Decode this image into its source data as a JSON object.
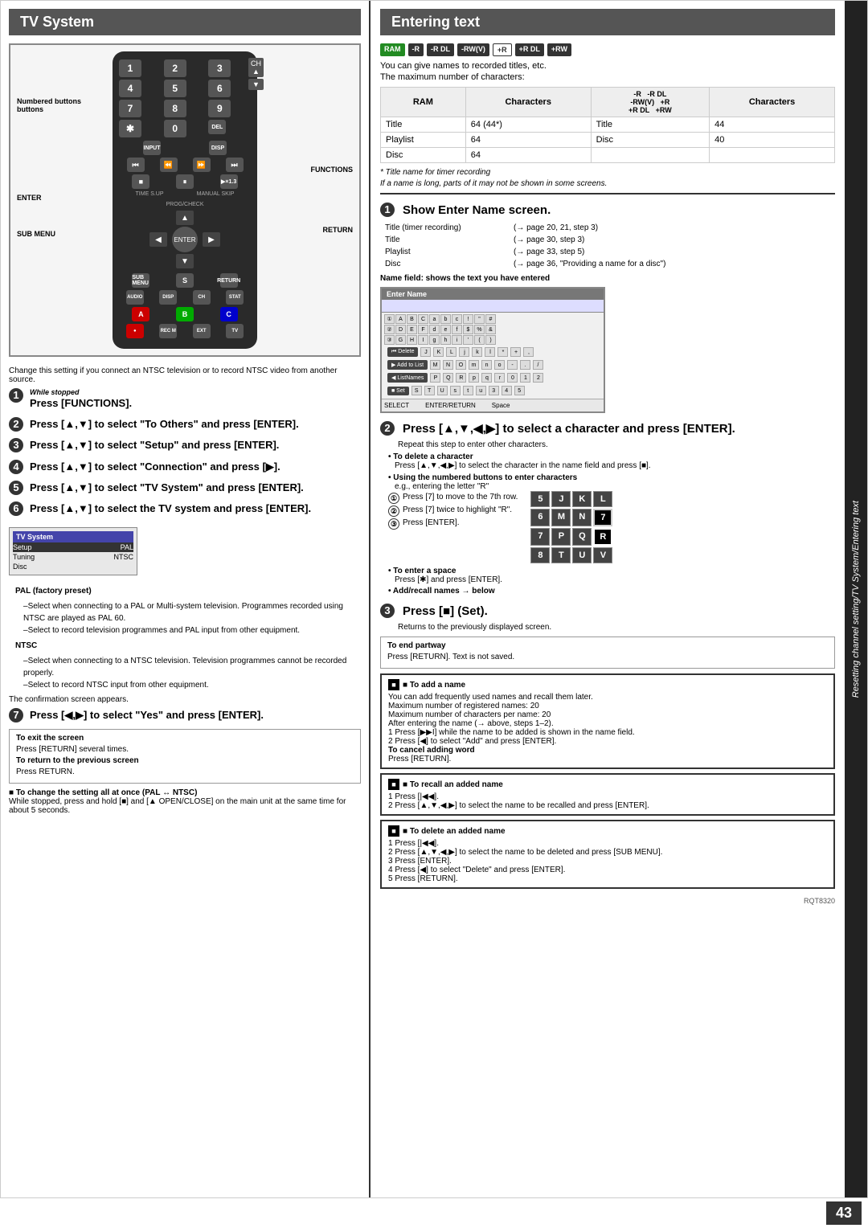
{
  "left": {
    "title": "TV System",
    "remote": {
      "numbered_buttons_label": "Numbered buttons",
      "enter_label": "ENTER",
      "sub_menu_label": "SUB MENU",
      "functions_label": "FUNCTIONS",
      "return_label": "RETURN",
      "numpad": [
        "1",
        "2",
        "3",
        "4",
        "5",
        "6",
        "7",
        "8",
        "9",
        "*",
        "0",
        "DELETE"
      ],
      "ch_up": "▲",
      "ch_down": "▼"
    },
    "intro_text": "Change this setting if you connect an NTSC television or to record NTSC video from another source.",
    "steps": [
      {
        "num": "1",
        "while_label": "While stopped",
        "main": "Press [FUNCTIONS]."
      },
      {
        "num": "2",
        "main": "Press [▲,▼] to select \"To Others\" and press [ENTER]."
      },
      {
        "num": "3",
        "main": "Press [▲,▼] to select \"Setup\" and press [ENTER]."
      },
      {
        "num": "4",
        "main": "Press [▲,▼] to select \"Connection\" and press [▶]."
      },
      {
        "num": "5",
        "main": "Press [▲,▼] to select \"TV System\" and press [ENTER]."
      },
      {
        "num": "6",
        "main": "Press [▲,▼] to select the TV system and press [ENTER]."
      }
    ],
    "screen_items": [
      {
        "label": "Setup",
        "value": "TV System"
      },
      {
        "label": "",
        "value": "PAL",
        "selected": true
      },
      {
        "label": "Tuning",
        "value": "NTSC"
      },
      {
        "label": "Disc",
        "value": ""
      }
    ],
    "pal_note_title": "PAL (factory preset)",
    "pal_notes": [
      "Select when connecting to a PAL or Multi-system television. Programmes recorded using NTSC are played as PAL 60.",
      "Select to record television programmes and PAL input from other equipment."
    ],
    "ntsc_title": "NTSC",
    "ntsc_notes": [
      "Select when connecting to a NTSC television. Television programmes cannot be recorded properly.",
      "Select to record NTSC input from other equipment."
    ],
    "confirmation_text": "The confirmation screen appears.",
    "step7": {
      "num": "7",
      "main": "Press [◀,▶] to select \"Yes\" and press [ENTER]."
    },
    "exit_note_title": "To exit the screen",
    "exit_note": "Press [RETURN] several times.",
    "return_note_title": "To return to the previous screen",
    "return_note": "Press RETURN.",
    "pal_ntsc_change_title": "■ To change the setting all at once (PAL ↔ NTSC)",
    "pal_ntsc_change_text": "While stopped, press and hold [■] and [▲ OPEN/CLOSE] on the main unit at the same time for about 5 seconds."
  },
  "right": {
    "title": "Entering text",
    "badges": [
      "RAM",
      "-R",
      "-R DL",
      "-RW(V)",
      "+R",
      "+R DL",
      "+RW"
    ],
    "badge_colors": {
      "RAM": "green",
      "-R": "dark",
      "-R DL": "dark",
      "-RW(V)": "dark",
      "+R": "outline",
      "+R DL": "dark",
      "+RW": "dark"
    },
    "intro1": "You can give names to recorded titles, etc.",
    "intro2": "The maximum number of characters:",
    "chars_table": {
      "headers": [
        "RAM",
        "Characters",
        "-R  -R DL\n-RW(V)  +R\n+R DL  +RW",
        "Characters"
      ],
      "rows": [
        [
          "Title",
          "64 (44*)",
          "Title",
          "44"
        ],
        [
          "Playlist",
          "64",
          "Disc",
          "40"
        ],
        [
          "Disc",
          "64",
          "",
          ""
        ]
      ]
    },
    "timer_note": "* Title name for timer recording",
    "long_name_note": "If a name is long, parts of it may not be shown in some screens.",
    "step1": {
      "num": "1",
      "title": "Show Enter Name screen.",
      "items": [
        {
          "label": "Title (timer recording)",
          "ref": "(→ page 20, 21, step 3)"
        },
        {
          "label": "Title",
          "ref": "(→ page 30, step 3)"
        },
        {
          "label": "Playlist",
          "ref": "(→ page 33, step 5)"
        },
        {
          "label": "Disc",
          "ref": "(→ page 36, \"Providing a name for a disc\")"
        }
      ],
      "name_field_note": "Name field: shows the text you have entered"
    },
    "step2": {
      "num": "2",
      "title": "Press [▲,▼,◀,▶] to select a character and press [ENTER].",
      "sub_text": "Repeat this step to enter other characters.",
      "delete_note_title": "• To delete a character",
      "delete_note": "Press [▲,▼,◀,▶] to select the character in the name field and press [■].",
      "numbered_title": "• Using the numbered buttons to enter characters",
      "numbered_example": "e.g., entering the letter \"R\"",
      "circled_steps": [
        "Press [7] to move to the 7th row.",
        "Press [7] twice to highlight \"R\".",
        "Press [ENTER]."
      ],
      "space_note_title": "• To enter a space",
      "space_note": "Press [✱] and press [ENTER].",
      "recall_note": "• Add/recall names → below"
    },
    "char_grid": {
      "rows": [
        [
          "5",
          "J",
          "K",
          "L"
        ],
        [
          "6",
          "M",
          "N",
          "7"
        ],
        [
          "7",
          "P",
          "Q",
          "R"
        ],
        [
          "8",
          "T",
          "U",
          "V"
        ]
      ],
      "highlight": [
        2,
        3
      ]
    },
    "step3": {
      "num": "3",
      "title": "Press [■] (Set).",
      "sub_text": "Returns to the previously displayed screen."
    },
    "end_partway_title": "To end partway",
    "end_partway_text": "Press [RETURN]. Text is not saved.",
    "add_name_section": {
      "title": "■ To add a name",
      "lines": [
        "You can add frequently used names and recall them later.",
        "Maximum number of registered names: 20",
        "Maximum number of characters per name: 20",
        "After entering the name (→ above, steps 1–2).",
        "1  Press [▶▶I] while the name to be added is shown in the name field.",
        "2  Press [◀] to select \"Add\" and press [ENTER].",
        "To cancel adding word",
        "Press [RETURN]."
      ]
    },
    "recall_name_section": {
      "title": "■ To recall an added name",
      "lines": [
        "1  Press [|◀◀].",
        "2  Press [▲,▼,◀,▶] to select the name to be recalled and press [ENTER]."
      ]
    },
    "delete_name_section": {
      "title": "■ To delete an added name",
      "lines": [
        "1  Press [|◀◀].",
        "2  Press [▲,▼,◀,▶] to select the name to be deleted and press [SUB MENU].",
        "3  Press [ENTER].",
        "4  Press [◀] to select \"Delete\" and press [ENTER].",
        "5  Press [RETURN]."
      ]
    },
    "rqt_code": "RQT8320",
    "page_num": "43",
    "vertical_label": "Resetting channel setting/TV System/Entering text"
  }
}
